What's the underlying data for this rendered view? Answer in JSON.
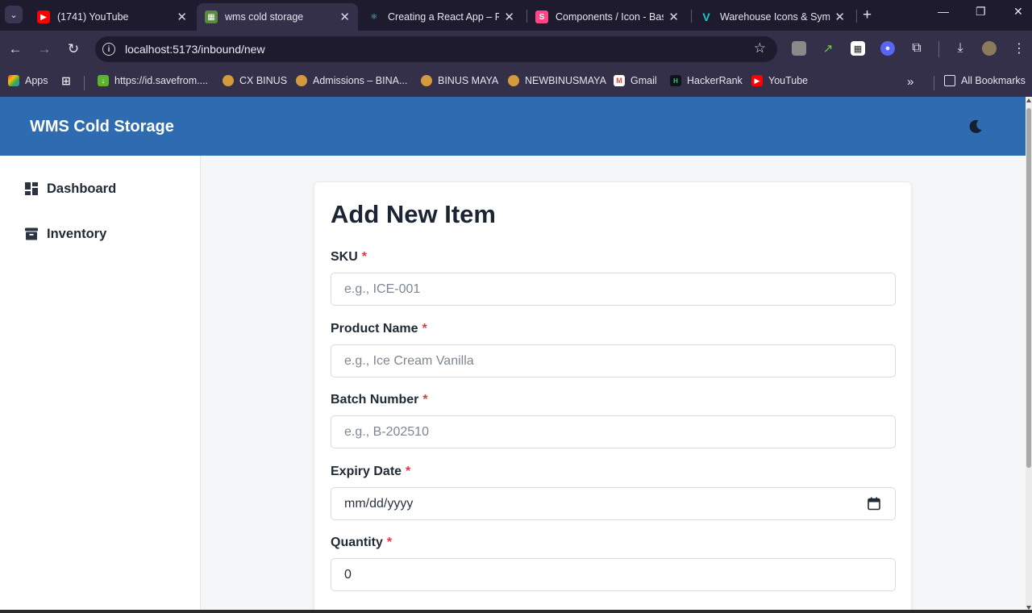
{
  "browser": {
    "tabs": [
      {
        "title": "(1741) YouTube",
        "favicon": "youtube-icon",
        "active": false
      },
      {
        "title": "wms cold storage",
        "favicon": "warehouse-app-icon",
        "active": true
      },
      {
        "title": "Creating a React App – R",
        "favicon": "react-icon",
        "active": false
      },
      {
        "title": "Components / Icon - Bas",
        "favicon": "storybook-icon",
        "active": false
      },
      {
        "title": "Warehouse Icons & Symb",
        "favicon": "vuetify-icon",
        "active": false
      }
    ],
    "url": "localhost:5173/inbound/new",
    "bookmarks": [
      {
        "label": "Apps",
        "icon": "apps-grid-icon"
      },
      {
        "label": "",
        "icon": "tab-groups-icon"
      },
      {
        "label": "https://id.savefrom....",
        "icon": "download-arrow-icon"
      },
      {
        "label": "CX BINUS",
        "icon": "binus-icon"
      },
      {
        "label": "Admissions – BINA...",
        "icon": "binus-icon"
      },
      {
        "label": "BINUS MAYA",
        "icon": "binus-icon"
      },
      {
        "label": "NEWBINUSMAYA",
        "icon": "binus-icon"
      },
      {
        "label": "Gmail",
        "icon": "gmail-icon"
      },
      {
        "label": "HackerRank",
        "icon": "hackerrank-icon"
      },
      {
        "label": "YouTube",
        "icon": "youtube-icon"
      }
    ],
    "all_bookmarks_label": "All Bookmarks",
    "overflow_label": "»"
  },
  "app": {
    "brand": "WMS Cold Storage",
    "nav": [
      {
        "label": "Dashboard",
        "icon": "dashboard-icon"
      },
      {
        "label": "Inventory",
        "icon": "archive-box-icon"
      }
    ],
    "form": {
      "title": "Add New Item",
      "required_marker": "*",
      "fields": [
        {
          "label": "SKU",
          "placeholder": "e.g., ICE-001",
          "value": ""
        },
        {
          "label": "Product Name",
          "placeholder": "e.g., Ice Cream Vanilla",
          "value": ""
        },
        {
          "label": "Batch Number",
          "placeholder": "e.g., B-202510",
          "value": ""
        },
        {
          "label": "Expiry Date",
          "placeholder": "mm/dd/yyyy",
          "value": ""
        },
        {
          "label": "Quantity",
          "placeholder": "",
          "value": "0"
        }
      ]
    }
  },
  "colors": {
    "header_bg": "#2f6bb1",
    "required": "#e0393e",
    "browser_frame": "#35304a"
  }
}
